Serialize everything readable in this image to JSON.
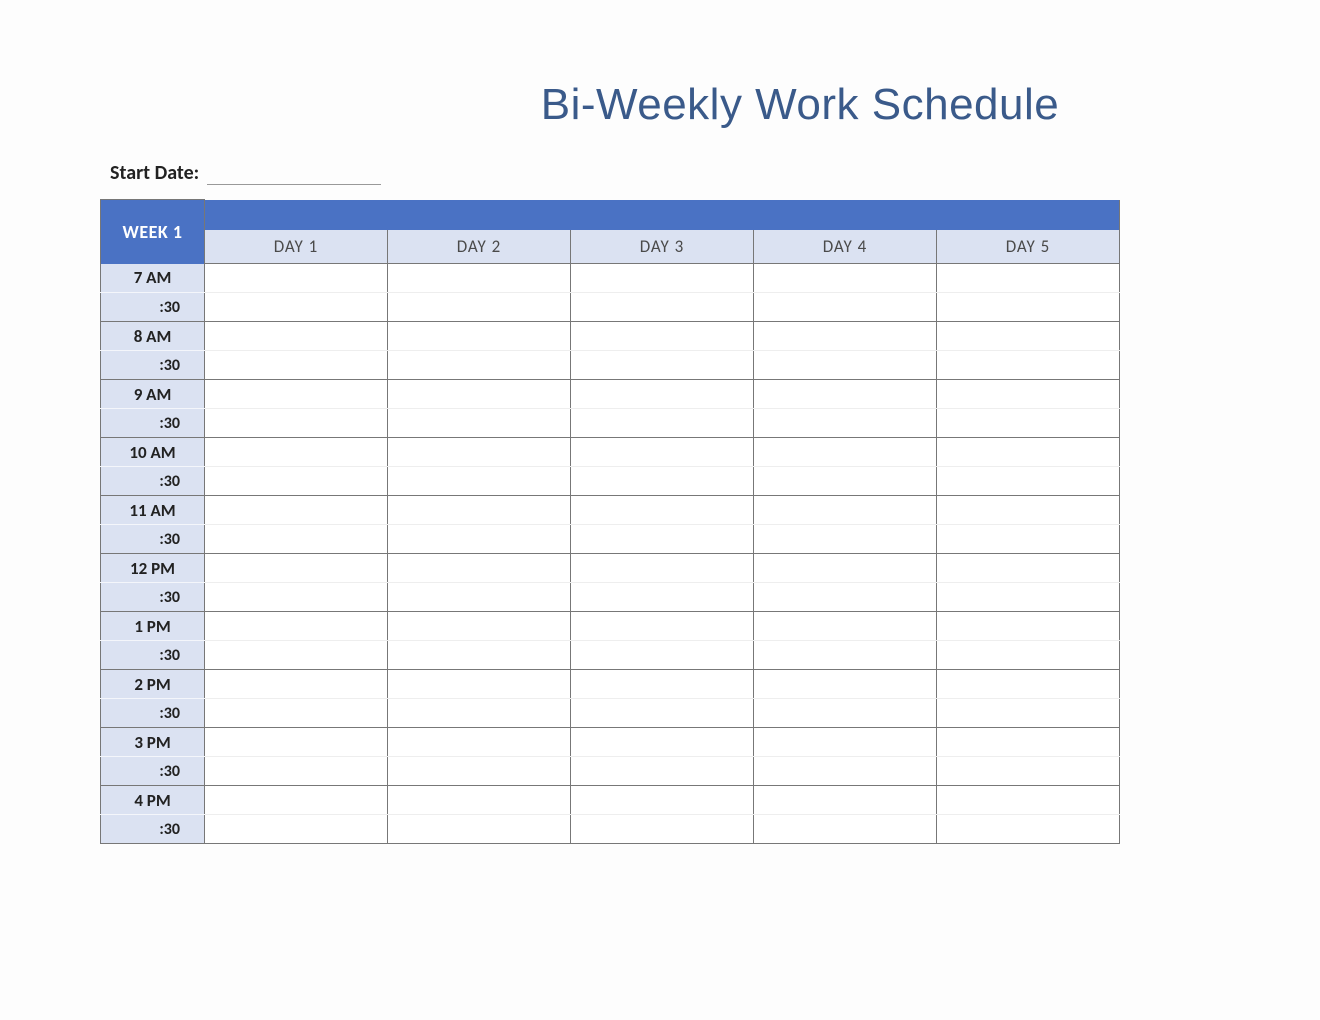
{
  "title": "Bi-Weekly Work Schedule",
  "start_date_label": "Start Date:",
  "start_date_value": "",
  "week_label": "WEEK 1",
  "days": [
    "DAY 1",
    "DAY 2",
    "DAY 3",
    "DAY 4",
    "DAY 5"
  ],
  "half_label": ":30",
  "hours": [
    "7 AM",
    "8 AM",
    "9 AM",
    "10 AM",
    "11 AM",
    "12 PM",
    "1 PM",
    "2 PM",
    "3 PM",
    "4 PM"
  ]
}
